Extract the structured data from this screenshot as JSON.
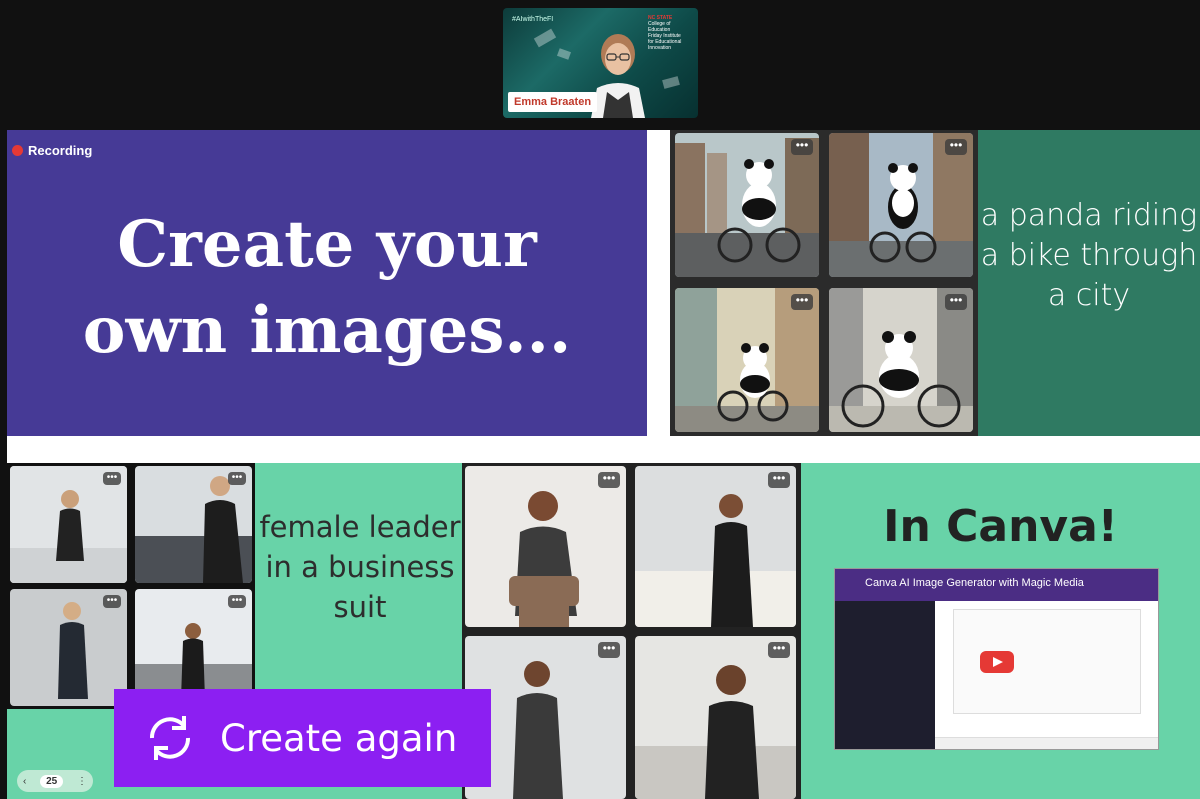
{
  "presenter": {
    "hashtag": "#AIwithTheFI",
    "logo_brand": "NC STATE",
    "logo_lines": [
      "College of Education",
      "Friday Institute",
      "for Educational Innovation"
    ],
    "name": "Emma Braaten"
  },
  "recording": {
    "label": "Recording",
    "color": "#e53935"
  },
  "slide": {
    "title_line1": "Create your",
    "title_line2": "own images...",
    "panda_caption": "a panda riding a bike through a city",
    "leader_caption": "female leader in a business suit",
    "canva_heading": "In Canva!",
    "create_again_label": "Create again",
    "video_title": "Canva AI Image Generator with Magic Media"
  },
  "pager": {
    "prev": "‹",
    "page": "25",
    "menu": "⋮"
  },
  "more_label": "•••",
  "colors": {
    "title_bg": "#463a96",
    "panda_caption_bg": "#2f7a62",
    "band_bg": "#68d3a8",
    "create_again_bg": "#8c1ff2"
  }
}
